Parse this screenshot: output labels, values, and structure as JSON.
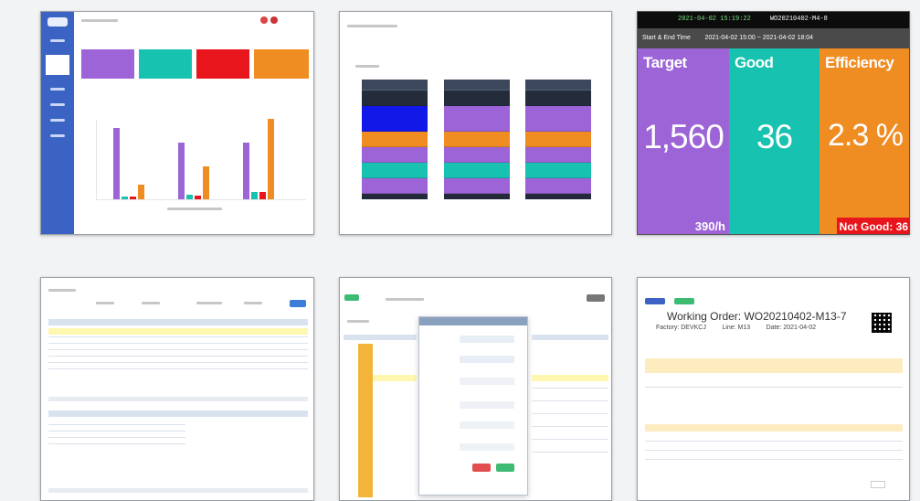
{
  "tile3": {
    "header_time": "2021-04-02 15:19:22",
    "header_order": "WO20210402-M4-8",
    "start_end_label": "Start & End Time",
    "start_end_value": "2021-04-02 15:00 ~ 2021-04-02 18:04",
    "panels": [
      {
        "title": "Target",
        "value": "1,560",
        "foot": "390/h",
        "color": "#9c64d6"
      },
      {
        "title": "Good",
        "value": "36",
        "foot": "",
        "color": "#17c2b0"
      },
      {
        "title": "Efficiency",
        "value": "2.3 %",
        "foot": "Not Good: 36",
        "color": "#ef8c22"
      }
    ]
  },
  "tile6": {
    "title": "Working Order: WO20210402-M13-7",
    "factory": "Factory: DEVKCJ",
    "line": "Line: M13",
    "date": "Date: 2021-04-02"
  },
  "colors": {
    "purple": "#9c64d6",
    "teal": "#17c2b0",
    "red": "#e8161c",
    "orange": "#ef8c22",
    "blue": "#3b63c4",
    "green": "#3dbb73"
  }
}
